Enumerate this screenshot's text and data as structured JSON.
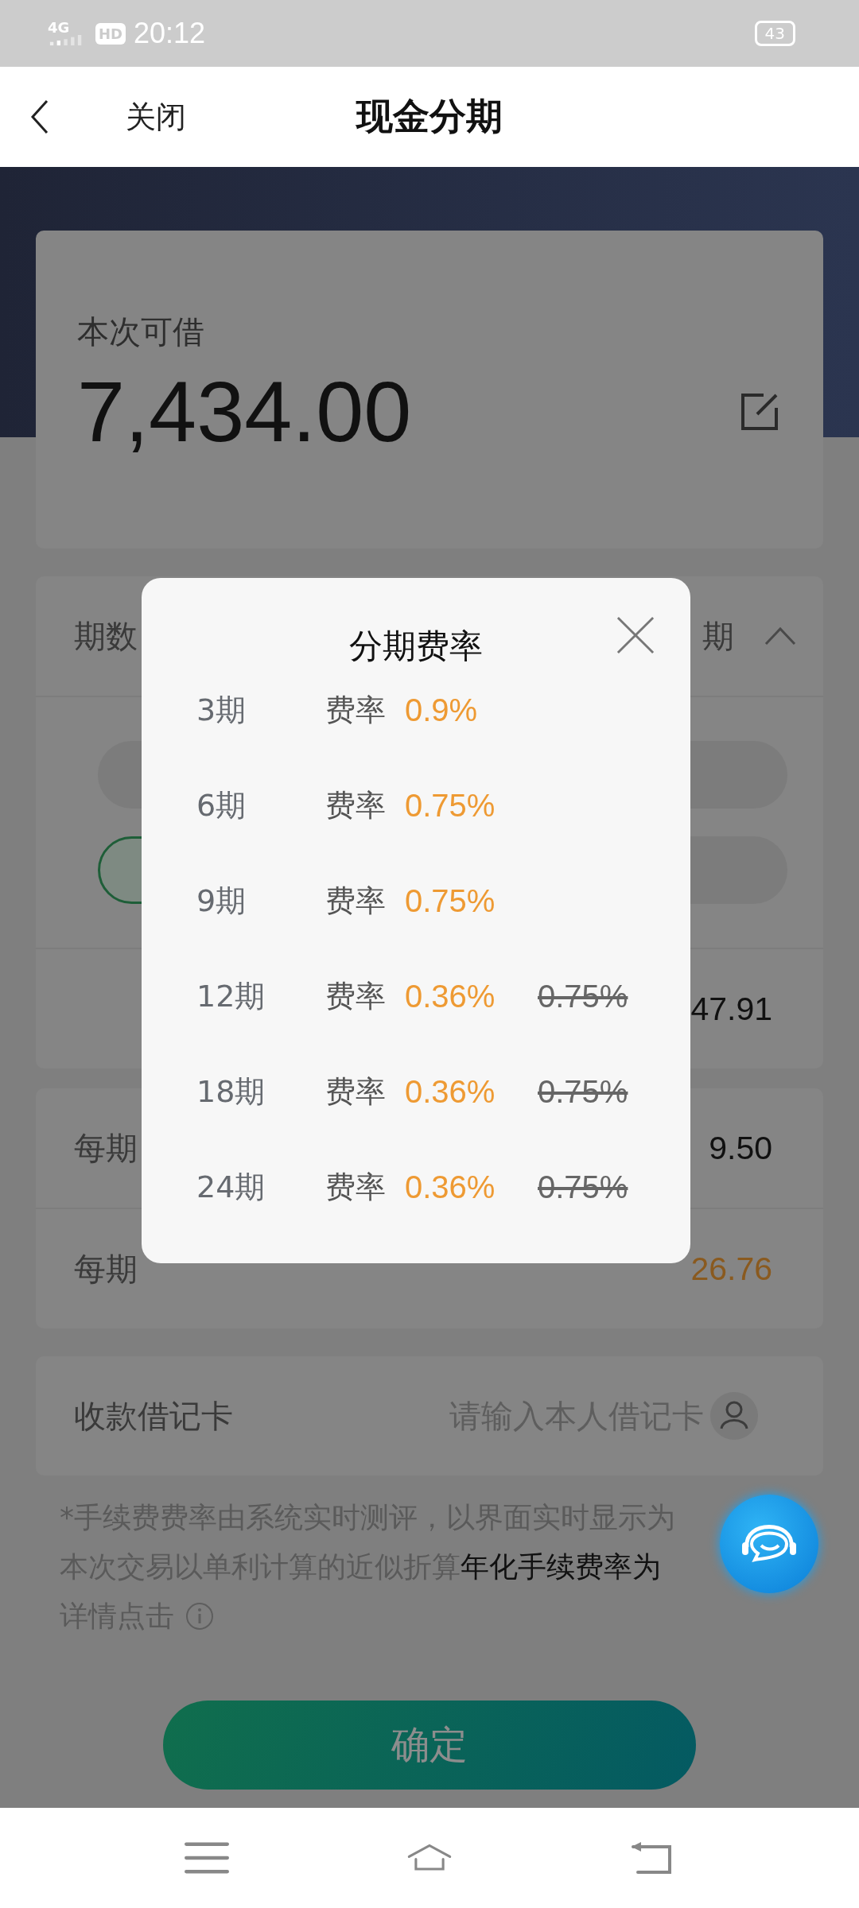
{
  "status_bar": {
    "network": "4G",
    "hd": "HD",
    "time": "20:12",
    "battery": "43"
  },
  "header": {
    "close": "关闭",
    "title": "现金分期"
  },
  "loan_card": {
    "label": "本次可借",
    "amount": "7,434.00"
  },
  "term_card": {
    "label": "期数",
    "value": "期",
    "expanded": true,
    "options": [
      {
        "selected": false
      },
      {
        "selected": false
      },
      {
        "selected": true
      },
      {
        "selected": false
      }
    ],
    "fee_value": "47.91"
  },
  "summary": [
    {
      "label": "每期",
      "value": "9.50",
      "kind": "plain"
    },
    {
      "label": "每期",
      "value": "26.76",
      "kind": "fee"
    }
  ],
  "debit_card": {
    "label": "收款借记卡",
    "placeholder": "请输入本人借记卡"
  },
  "footnote": {
    "lines": [
      "*手续费费率由系统实时测评，以界面实时显示为",
      "本次交易以单利计算的近似折算**年化手续费率为**"
    ],
    "link": "详情点击"
  },
  "confirm_button": "确定",
  "modal": {
    "title": "分期费率",
    "rows": [
      {
        "term": "3期",
        "label": "费率",
        "rate": "0.9%"
      },
      {
        "term": "6期",
        "label": "费率",
        "rate": "0.75%"
      },
      {
        "term": "9期",
        "label": "费率",
        "rate": "0.75%"
      },
      {
        "term": "12期",
        "label": "费率",
        "rate": "0.36%",
        "original": "0.75%"
      },
      {
        "term": "18期",
        "label": "费率",
        "rate": "0.36%",
        "original": "0.75%"
      },
      {
        "term": "24期",
        "label": "费率",
        "rate": "0.36%",
        "original": "0.75%"
      }
    ]
  }
}
